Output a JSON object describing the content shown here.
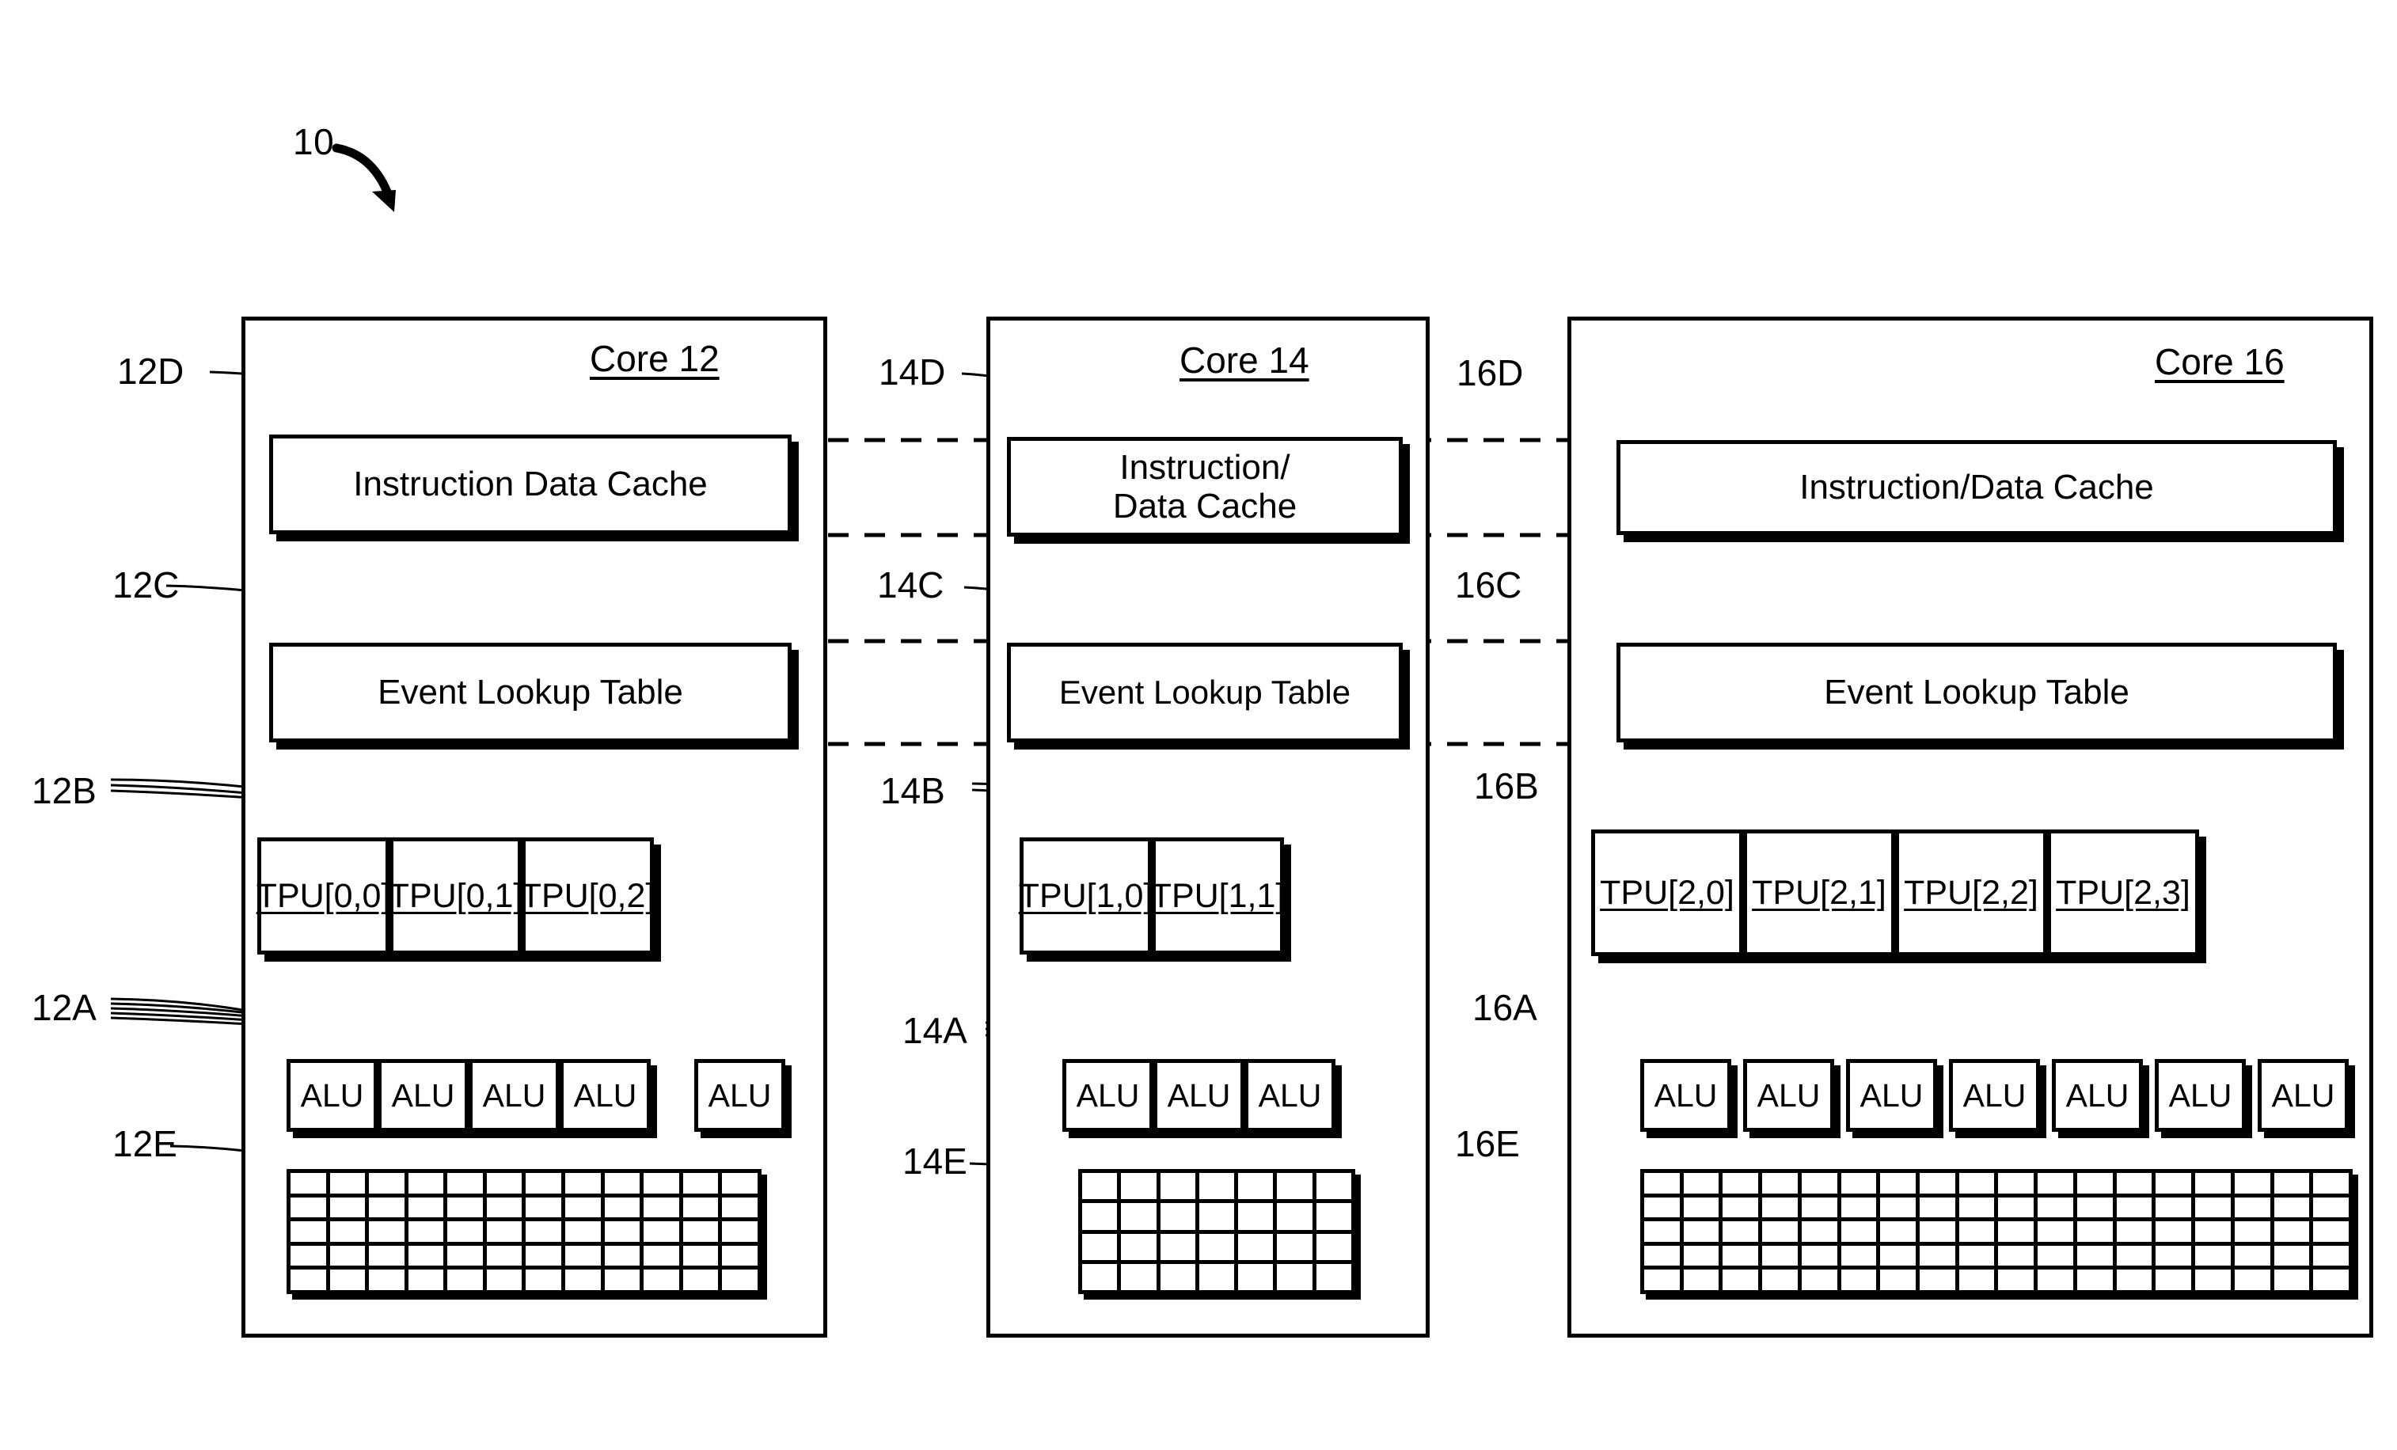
{
  "figure": {
    "number": "10",
    "arrow": "curved-arrow-down-right"
  },
  "cores": [
    {
      "id": "core-12",
      "title": "Core 12",
      "cache": {
        "label": "Instruction Data Cache",
        "ref": "12D"
      },
      "event_table": {
        "label": "Event Lookup Table",
        "ref": "12C"
      },
      "tpu": {
        "ref": "12B",
        "items": [
          "TPU[0,0]",
          "TPU[0,1]",
          "TPU[0,2]"
        ]
      },
      "alu": {
        "ref": "12A",
        "label": "ALU",
        "count": 5,
        "items": [
          "ALU",
          "ALU",
          "ALU",
          "ALU",
          "ALU"
        ]
      },
      "memory": {
        "ref": "12E",
        "columns": 12,
        "rows": 5
      }
    },
    {
      "id": "core-14",
      "title": "Core 14",
      "cache": {
        "label": "Instruction/\nData Cache",
        "ref": "14D"
      },
      "event_table": {
        "label": "Event Lookup Table",
        "ref": "14C"
      },
      "tpu": {
        "ref": "14B",
        "items": [
          "TPU[1,0]",
          "TPU[1,1]"
        ]
      },
      "alu": {
        "ref": "14A",
        "label": "ALU",
        "count": 3,
        "items": [
          "ALU",
          "ALU",
          "ALU"
        ]
      },
      "memory": {
        "ref": "14E",
        "columns": 7,
        "rows": 4
      }
    },
    {
      "id": "core-16",
      "title": "Core 16",
      "cache": {
        "label": "Instruction/Data Cache",
        "ref": "16D"
      },
      "event_table": {
        "label": "Event Lookup Table",
        "ref": "16C"
      },
      "tpu": {
        "ref": "16B",
        "items": [
          "TPU[2,0]",
          "TPU[2,1]",
          "TPU[2,2]",
          "TPU[2,3]"
        ]
      },
      "alu": {
        "ref": "16A",
        "label": "ALU",
        "count": 7,
        "items": [
          "ALU",
          "ALU",
          "ALU",
          "ALU",
          "ALU",
          "ALU",
          "ALU"
        ]
      },
      "memory": {
        "ref": "16E",
        "columns": 18,
        "rows": 5
      }
    }
  ]
}
